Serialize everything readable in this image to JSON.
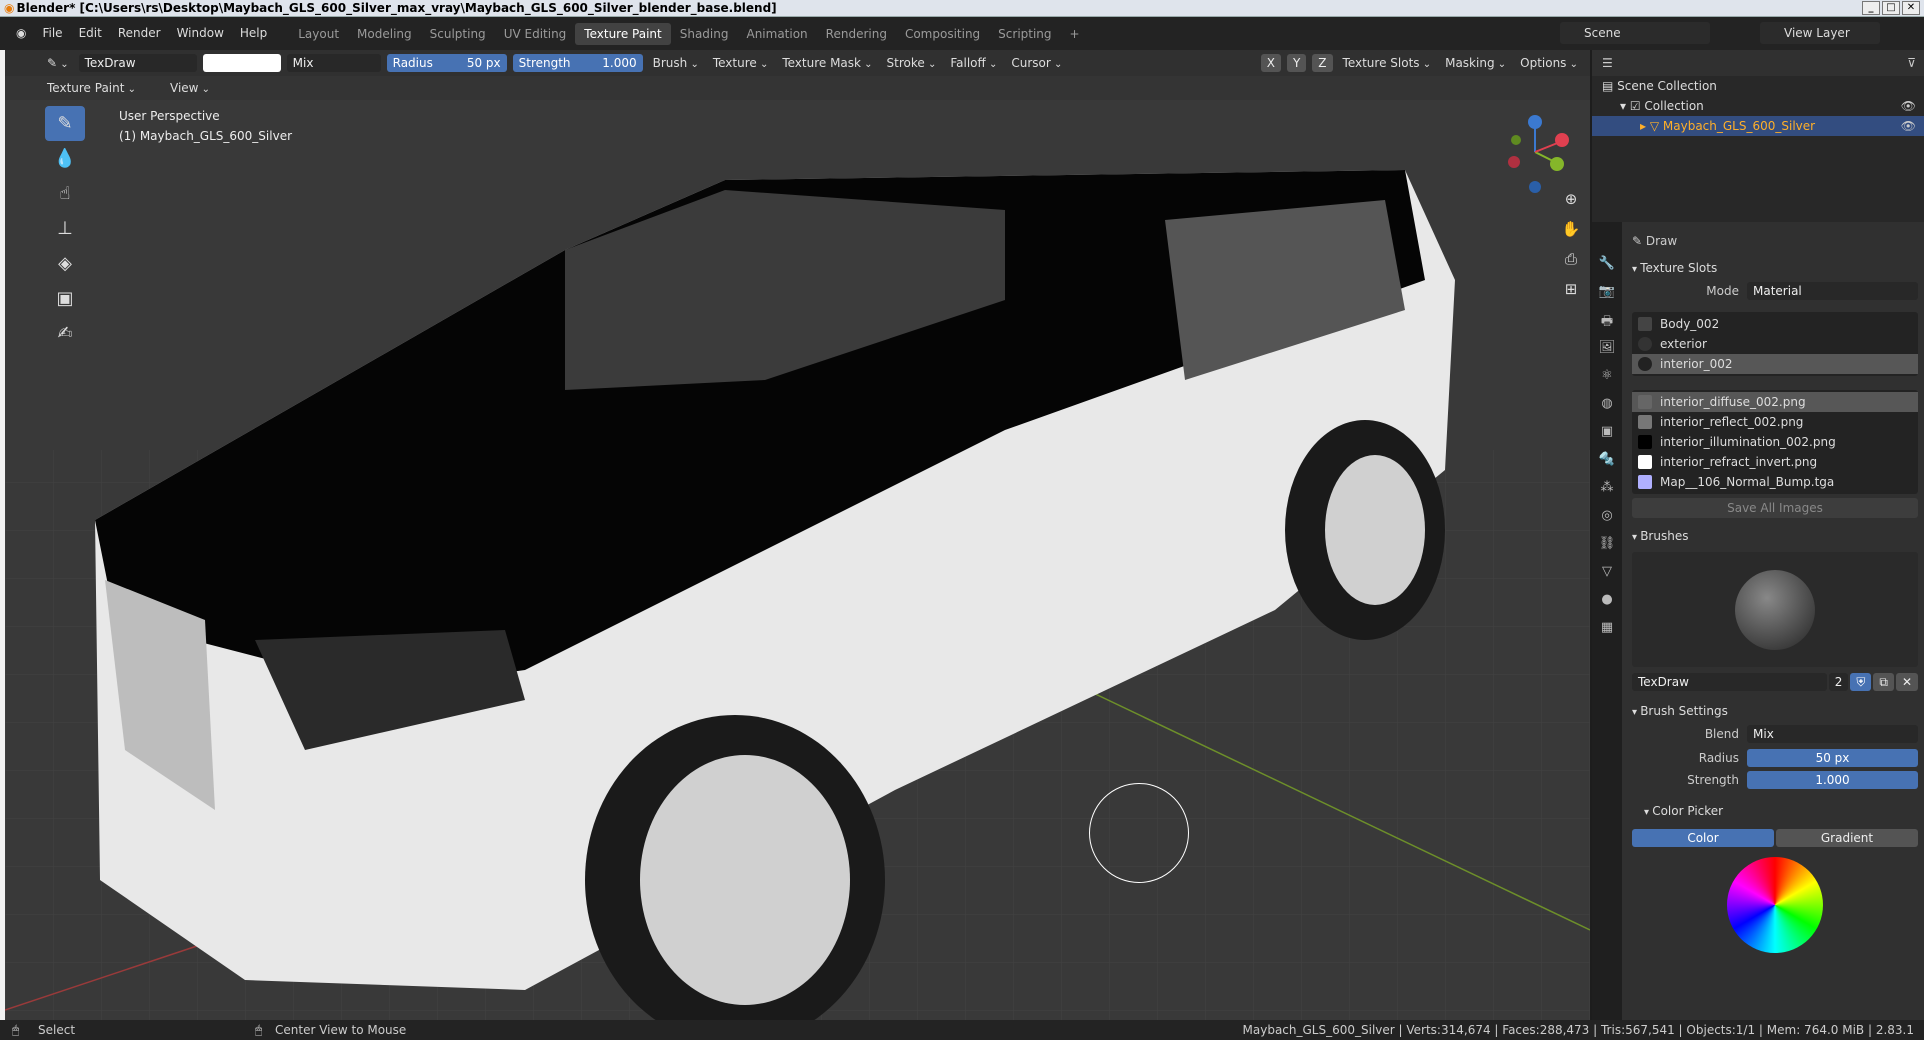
{
  "window": {
    "title": "Blender* [C:\\Users\\rs\\Desktop\\Maybach_GLS_600_Silver_max_vray\\Maybach_GLS_600_Silver_blender_base.blend]"
  },
  "menu": [
    "File",
    "Edit",
    "Render",
    "Window",
    "Help"
  ],
  "workspaces": [
    "Layout",
    "Modeling",
    "Sculpting",
    "UV Editing",
    "Texture Paint",
    "Shading",
    "Animation",
    "Rendering",
    "Compositing",
    "Scripting"
  ],
  "scene": "Scene",
  "view_layer": "View Layer",
  "tool_header": {
    "brush": "TexDraw",
    "blend": "Mix",
    "radius_label": "Radius",
    "radius": "50 px",
    "strength_label": "Strength",
    "strength": "1.000",
    "menus": [
      "Brush",
      "Texture",
      "Texture Mask",
      "Stroke",
      "Falloff",
      "Cursor"
    ],
    "axes": [
      "X",
      "Y",
      "Z"
    ],
    "right_menus": [
      "Texture Slots",
      "Masking",
      "Options"
    ]
  },
  "mode_header": {
    "mode": "Texture Paint",
    "view": "View"
  },
  "viewport": {
    "perspective": "User Perspective",
    "object": "(1) Maybach_GLS_600_Silver"
  },
  "outliner": {
    "scene_collection": "Scene Collection",
    "collection": "Collection",
    "object": "Maybach_GLS_600_Silver"
  },
  "properties": {
    "tool": "Draw",
    "texture_slots": "Texture Slots",
    "mode_label": "Mode",
    "mode": "Material",
    "materials": [
      "Body_002",
      "exterior",
      "interior_002"
    ],
    "images": [
      "interior_diffuse_002.png",
      "interior_reflect_002.png",
      "interior_illumination_002.png",
      "interior_refract_invert.png",
      "Map__106_Normal_Bump.tga"
    ],
    "save_all": "Save All Images",
    "brushes": "Brushes",
    "brush_name": "TexDraw",
    "brush_users": "2",
    "brush_settings": "Brush Settings",
    "blend_label": "Blend",
    "blend": "Mix",
    "radius_label": "Radius",
    "radius": "50 px",
    "strength_label": "Strength",
    "strength": "1.000",
    "color_picker": "Color Picker",
    "color_tab": "Color",
    "gradient_tab": "Gradient"
  },
  "status": {
    "select": "Select",
    "center": "Center View to Mouse",
    "stats": "Maybach_GLS_600_Silver | Verts:314,674 | Faces:288,473 | Tris:567,541 | Objects:1/1 | Mem: 764.0 MiB | 2.83.1"
  },
  "colors": {
    "accent": "#4772b3",
    "selected_obj": "#ffaf29"
  }
}
